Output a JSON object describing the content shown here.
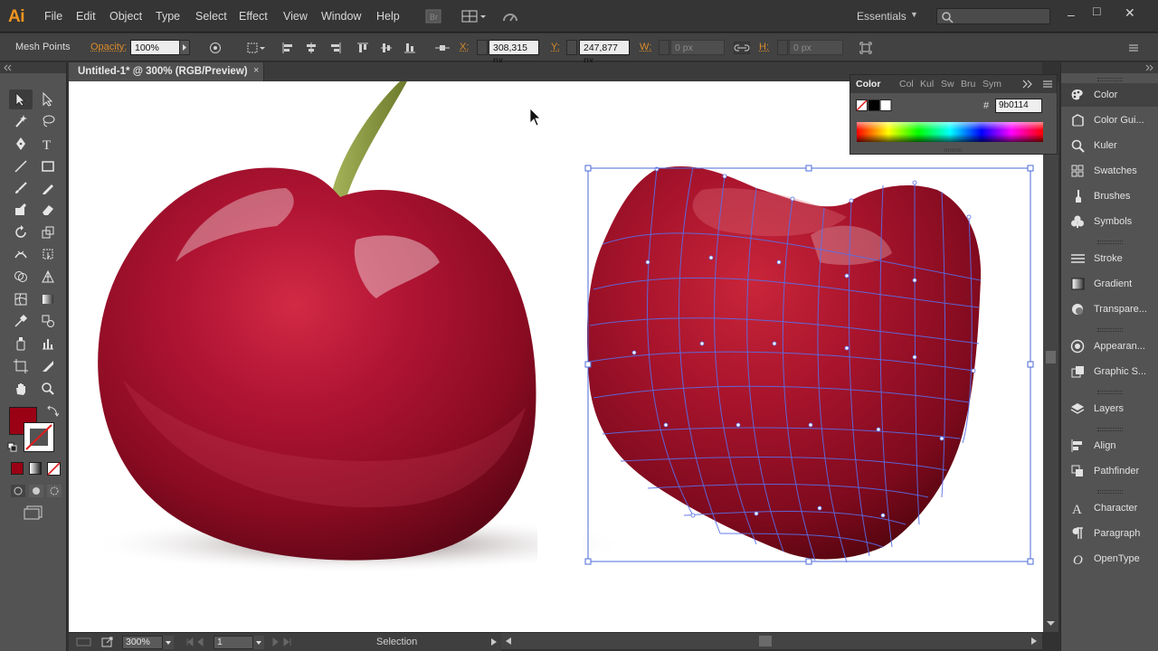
{
  "app": {
    "logo": "Ai"
  },
  "menu": [
    "File",
    "Edit",
    "Object",
    "Type",
    "Select",
    "Effect",
    "View",
    "Window",
    "Help"
  ],
  "workspace": {
    "label": "Essentials"
  },
  "search": {
    "placeholder": ""
  },
  "window_controls": {
    "minimize": "–",
    "maximize": "□",
    "close": "✕"
  },
  "controlbar": {
    "selection_label": "Mesh Points",
    "opacity_label": "Opacity:",
    "opacity_value": "100%",
    "x_label": "X:",
    "x_value": "308,315 px",
    "y_label": "Y:",
    "y_value": "247,877 px",
    "w_label": "W:",
    "w_value": "0 px",
    "h_label": "H:",
    "h_value": "0 px"
  },
  "document": {
    "tab_title": "Untitled-1* @ 300% (RGB/Preview)",
    "close": "×"
  },
  "colors": {
    "fill": "#9b0114",
    "accent": "#f0951f",
    "mesh_line": "#5a6ee8"
  },
  "statusbar": {
    "zoom": "300%",
    "artboard": "1",
    "tool": "Selection"
  },
  "color_panel": {
    "tabs": [
      "Color",
      "Col",
      "Kul",
      "Sw",
      "Bru",
      "Sym"
    ],
    "hash": "#",
    "hex_value": "9b0114"
  },
  "dock": {
    "items": [
      {
        "label": "Color",
        "icon": "palette-icon"
      },
      {
        "label": "Color Gui...",
        "icon": "color-guide-icon"
      },
      {
        "label": "Kuler",
        "icon": "kuler-icon"
      },
      {
        "label": "Swatches",
        "icon": "swatches-icon"
      },
      {
        "label": "Brushes",
        "icon": "brush-icon"
      },
      {
        "label": "Symbols",
        "icon": "symbols-icon"
      },
      {
        "label": "Stroke",
        "icon": "stroke-icon"
      },
      {
        "label": "Gradient",
        "icon": "gradient-icon"
      },
      {
        "label": "Transpare...",
        "icon": "transparency-icon"
      },
      {
        "label": "Appearan...",
        "icon": "appearance-icon"
      },
      {
        "label": "Graphic S...",
        "icon": "graphic-styles-icon"
      },
      {
        "label": "Layers",
        "icon": "layers-icon"
      },
      {
        "label": "Align",
        "icon": "align-icon"
      },
      {
        "label": "Pathfinder",
        "icon": "pathfinder-icon"
      },
      {
        "label": "Character",
        "icon": "character-icon"
      },
      {
        "label": "Paragraph",
        "icon": "paragraph-icon"
      },
      {
        "label": "OpenType",
        "icon": "opentype-icon"
      }
    ]
  }
}
